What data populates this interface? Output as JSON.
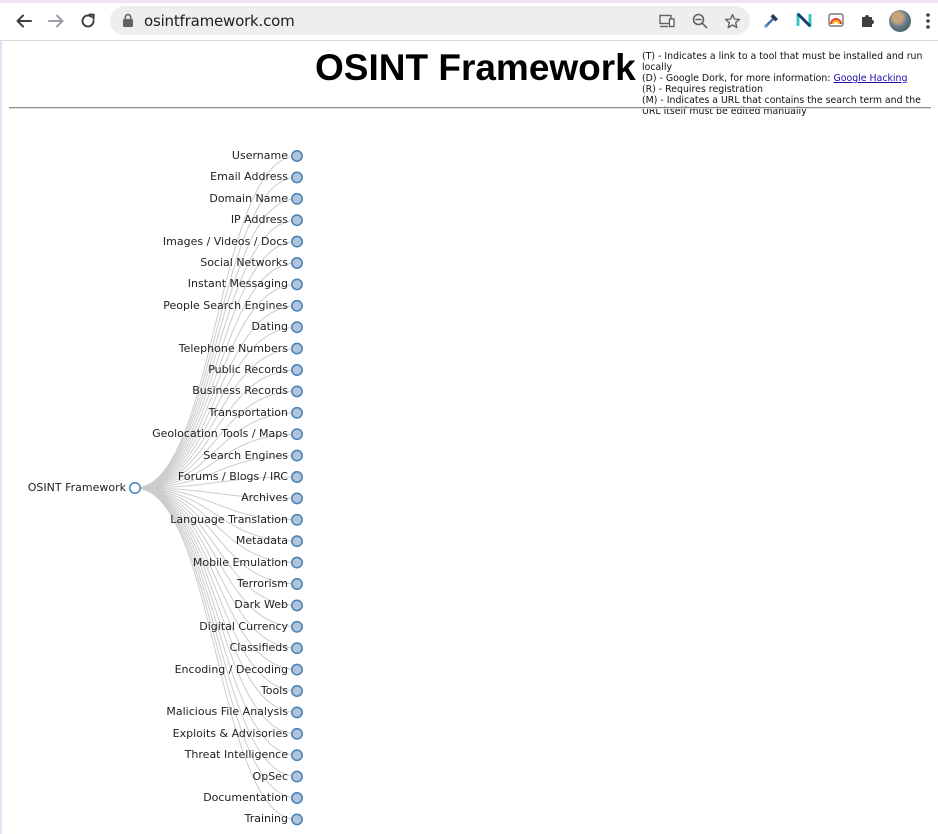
{
  "browser": {
    "url": "osintframework.com"
  },
  "header": {
    "title": "OSINT Framework",
    "legend": [
      {
        "text": "(T) - Indicates a link to a tool that must be installed and run locally"
      },
      {
        "text": "(D) - Google Dork, for more information: ",
        "link": "Google Hacking"
      },
      {
        "text": "(R) - Requires registration"
      },
      {
        "text": "(M) - Indicates a URL that contains the search term and the URL itself must be edited manually"
      }
    ]
  },
  "tree": {
    "root": "OSINT Framework",
    "children": [
      "Username",
      "Email Address",
      "Domain Name",
      "IP Address",
      "Images / Videos / Docs",
      "Social Networks",
      "Instant Messaging",
      "People Search Engines",
      "Dating",
      "Telephone Numbers",
      "Public Records",
      "Business Records",
      "Transportation",
      "Geolocation Tools / Maps",
      "Search Engines",
      "Forums / Blogs / IRC",
      "Archives",
      "Language Translation",
      "Metadata",
      "Mobile Emulation",
      "Terrorism",
      "Dark Web",
      "Digital Currency",
      "Classifieds",
      "Encoding / Decoding",
      "Tools",
      "Malicious File Analysis",
      "Exploits & Advisories",
      "Threat Intelligence",
      "OpSec",
      "Documentation",
      "Training"
    ]
  },
  "colors": {
    "node_fill": "#b0c4de",
    "node_stroke": "#4682b4",
    "link": "#cccccc"
  },
  "icons": {
    "back": "arrow-left-icon",
    "forward": "arrow-right-icon",
    "reload": "reload-icon",
    "lock": "lock-icon",
    "cast": "cast-icon",
    "zoom": "zoom-out-icon",
    "bookmark": "star-icon",
    "extensions": "puzzle-icon",
    "menu": "kebab-menu-icon"
  }
}
